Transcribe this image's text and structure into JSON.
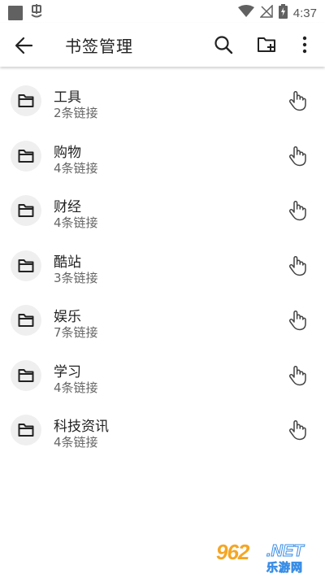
{
  "status_bar": {
    "time": "4:37",
    "icons": [
      "notification-square-icon",
      "app-notification-icon",
      "wifi-icon",
      "signal-off-icon",
      "battery-charging-icon"
    ]
  },
  "app_bar": {
    "title": "书签管理",
    "icons": [
      "back-arrow-icon",
      "search-icon",
      "add-folder-icon",
      "more-vert-icon"
    ]
  },
  "folders": [
    {
      "name": "工具",
      "count_text": "2条链接"
    },
    {
      "name": "购物",
      "count_text": "4条链接"
    },
    {
      "name": "财经",
      "count_text": "4条链接"
    },
    {
      "name": "酷站",
      "count_text": "3条链接"
    },
    {
      "name": "娱乐",
      "count_text": "7条链接"
    },
    {
      "name": "学习",
      "count_text": "4条链接"
    },
    {
      "name": "科技资讯",
      "count_text": "4条链接"
    }
  ],
  "watermark": {
    "number": "962",
    "domain": ".NET",
    "site_name": "乐游网"
  },
  "colors": {
    "status_icon": "#616161",
    "icon": "#222222",
    "folder_circle": "#efefef",
    "subtitle": "#666666"
  }
}
